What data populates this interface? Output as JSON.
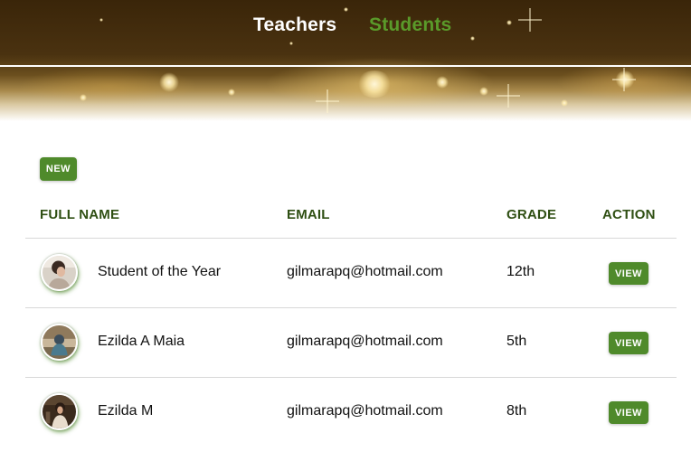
{
  "nav": {
    "teachers_label": "Teachers",
    "students_label": "Students",
    "active": "Students",
    "active_color": "#5a9a2a"
  },
  "toolbar": {
    "new_label": "NEW",
    "accent_color": "#4f8a2b"
  },
  "table": {
    "headers": {
      "full_name": "FULL NAME",
      "email": "EMAIL",
      "grade": "GRADE",
      "action": "ACTION"
    },
    "rows": [
      {
        "name": "Student of the Year",
        "email": "gilmarapq@hotmail.com",
        "grade": "12th",
        "action_label": "VIEW",
        "avatar": "student-photo"
      },
      {
        "name": "Ezilda A Maia",
        "email": "gilmarapq@hotmail.com",
        "grade": "5th",
        "action_label": "VIEW",
        "avatar": "student-photo"
      },
      {
        "name": "Ezilda M",
        "email": "gilmarapq@hotmail.com",
        "grade": "8th",
        "action_label": "VIEW",
        "avatar": "student-photo"
      }
    ]
  }
}
